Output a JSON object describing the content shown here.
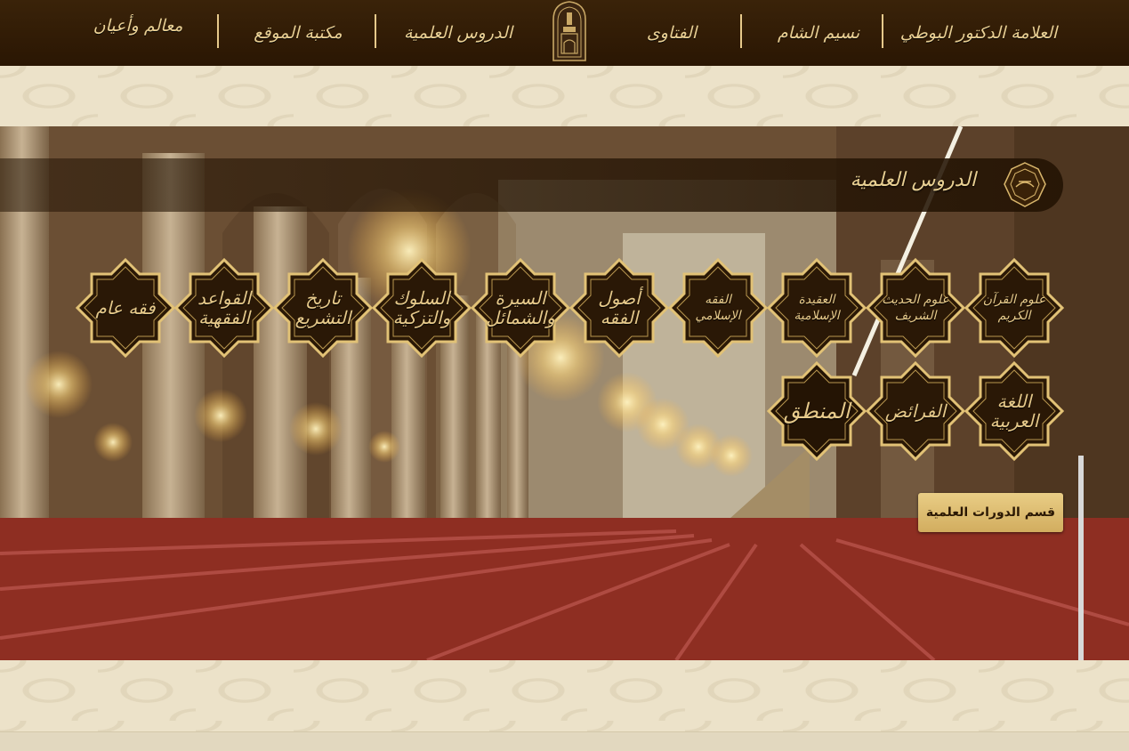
{
  "nav": {
    "items": [
      {
        "label": "العلامة الدكتور البوطي"
      },
      {
        "label": "نسيم الشام"
      },
      {
        "label": "الفتاوى"
      },
      {
        "label": "الدروس العلمية"
      },
      {
        "label": "مكتبة الموقع"
      },
      {
        "label": "معالم وأعيان"
      }
    ],
    "logo_icon": "mosque-emblem-icon"
  },
  "hero": {
    "title": "الدروس العلمية",
    "title_icon": "calligraphy-seal-icon",
    "categories_row1": [
      {
        "label": "علوم القرآن الكريم"
      },
      {
        "label": "علوم الحديث الشريف"
      },
      {
        "label": "العقيدة الإسلامية"
      },
      {
        "label": "الفقه الإسلامي"
      },
      {
        "label": "أصول الفقه"
      },
      {
        "label": "السيرة والشمائل"
      },
      {
        "label": "السلوك والتزكية"
      },
      {
        "label": "تاريخ التشريع"
      },
      {
        "label": "القواعد الفقهية"
      },
      {
        "label": "فقه عام"
      }
    ],
    "categories_row2": [
      {
        "label": "اللغة العربية"
      },
      {
        "label": "الفرائض"
      },
      {
        "label": "المنطق"
      }
    ],
    "courses_button": "قسم الدورات العلمية"
  },
  "colors": {
    "nav_background": "#2e1a05",
    "gold": "#e6c98a",
    "badge_fill": "#2a1806",
    "button_gold": "#ddbb70",
    "page_background": "#ece2c9"
  }
}
